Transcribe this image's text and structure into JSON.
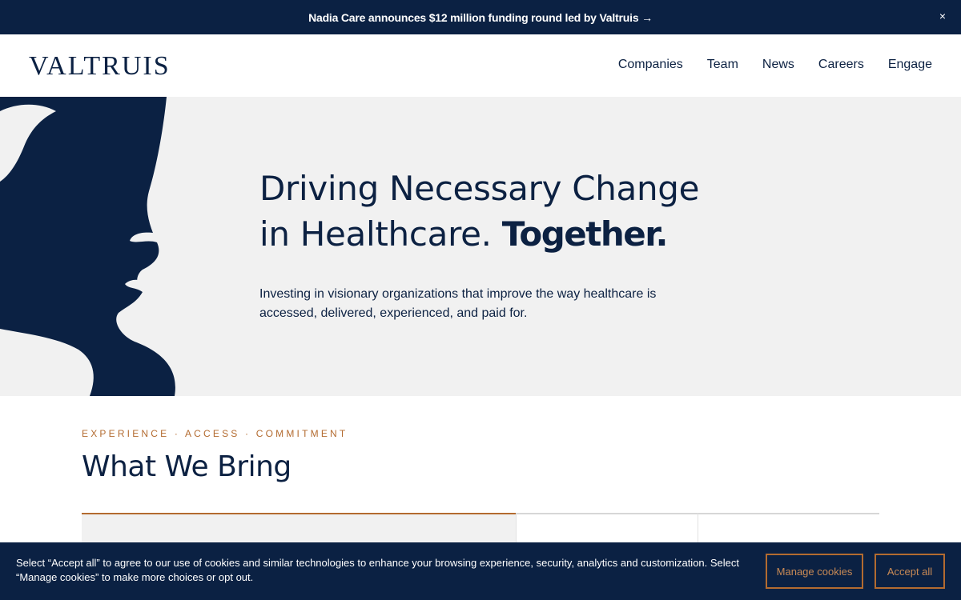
{
  "announcement": {
    "text": "Nadia Care announces $12 million funding round led by Valtruis →",
    "close_label": "×"
  },
  "header": {
    "logo": "VALTRUIS",
    "nav": [
      "Companies",
      "Team",
      "News",
      "Careers",
      "Engage"
    ]
  },
  "hero": {
    "title_line1": "Driving Necessary Change",
    "title_line2": "in Healthcare.",
    "title_emphasis": "Together.",
    "subtitle": "Investing in visionary organizations that improve the way healthcare is accessed, delivered, experienced, and paid for.",
    "art_icon": "face-profile-art"
  },
  "bring": {
    "eyebrow": "EXPERIENCE · ACCESS · COMMITMENT",
    "title": "What We Bring"
  },
  "cookie": {
    "text": "Select “Accept all” to agree to our use of cookies and similar technologies to enhance your browsing experience, security, analytics and customization. Select “Manage cookies” to make more choices or opt out.",
    "manage_label": "Manage cookies",
    "accept_label": "Accept all"
  },
  "colors": {
    "navy": "#0b2143",
    "accent": "#b36b30",
    "hero_bg": "#f1f1f1"
  }
}
